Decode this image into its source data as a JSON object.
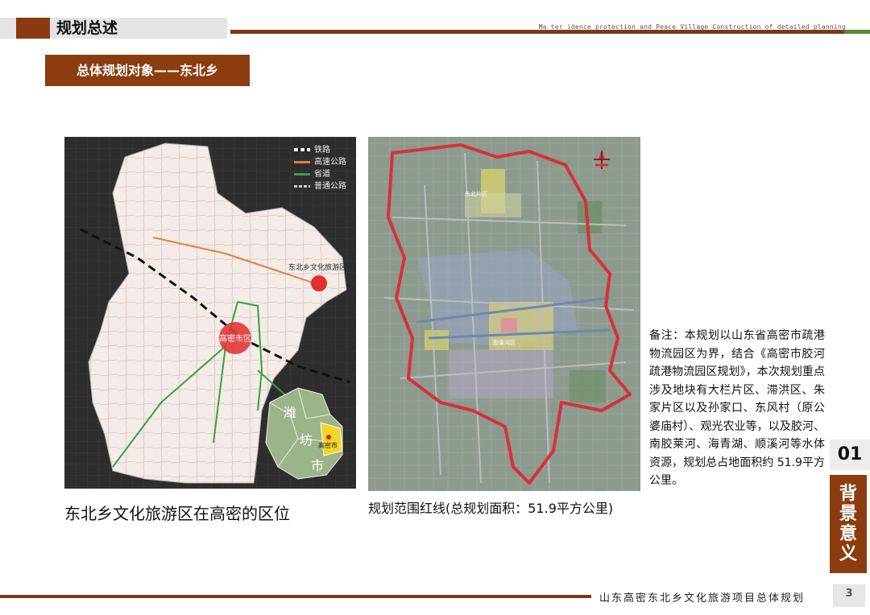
{
  "header": {
    "title": "规划总述",
    "english_line": "Ma  ter    idence protection and Peace Village Construction of detailed planning"
  },
  "subtitle": "总体规划对象——东北乡",
  "map1": {
    "legend": [
      {
        "label": "铁路",
        "color": "#ffffff",
        "style": "rail"
      },
      {
        "label": "高速公路",
        "color": "#e08040",
        "style": "solid"
      },
      {
        "label": "省道",
        "color": "#3aa040",
        "style": "solid"
      },
      {
        "label": "普通公路",
        "color": "#cccccc",
        "style": "dashed"
      }
    ],
    "labels": {
      "tourism_zone": "东北乡文化旅游区",
      "city_center": "高密市区",
      "inset_chars": [
        "潍",
        "坊",
        "市"
      ],
      "inset_city": "高密市"
    },
    "caption": "东北乡文化旅游区在高密的区位"
  },
  "map2": {
    "caption": "规划范围红线(总规划面积：51.9平方公里)",
    "labels": [
      "东北片区",
      "胶莱河区"
    ],
    "boundary_color": "#d8303a"
  },
  "note": "备注：本规划以山东省高密市疏港物流园区为界，结合《高密市胶河疏港物流园区规划》，本次规划重点涉及地块有大栏片区、滞洪区、朱家片区以及孙家口、东风村（原公婆庙村）、观光农业等，以及胶河、南胶莱河、海青湖、顺溪河等水体资源，规划总占地面积约 51.9平方公里。",
  "side": {
    "number": "01",
    "label": "背景意义"
  },
  "footer": {
    "title": "山东高密东北乡文化旅游项目总体规划",
    "page": "3"
  },
  "colors": {
    "brown": "#8b3d10",
    "accent_green": "#5a8a2a"
  }
}
